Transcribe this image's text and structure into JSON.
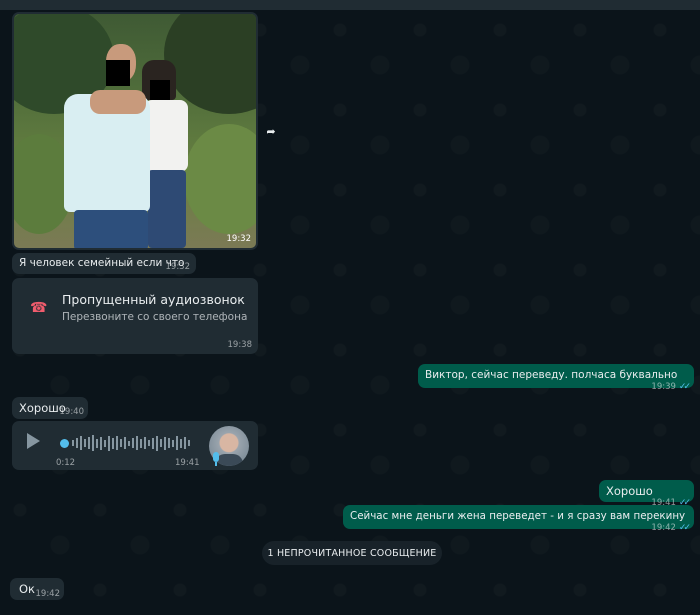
{
  "messages": {
    "photo_time": "19:32",
    "caption": {
      "text": "Я человек семейный если что",
      "time": "19:32"
    },
    "missed_call": {
      "title": "Пропущенный аудиозвонок",
      "subtitle": "Перезвоните со своего телефона",
      "time": "19:38"
    },
    "out1": {
      "text": "Виктор, сейчас переведу. полчаса буквально",
      "time": "19:39"
    },
    "in_ok": {
      "text": "Хорошо",
      "time": "19:40"
    },
    "voice": {
      "duration": "0:12",
      "time": "19:41"
    },
    "out2": {
      "text": "Хорошо",
      "time": "19:41"
    },
    "out3": {
      "text": "Сейчас мне деньги жена переведет - и я сразу вам перекину",
      "time": "19:42"
    },
    "unread_divider": "1 НЕПРОЧИТАННОЕ СООБЩЕНИЕ",
    "last": {
      "text": "Ок",
      "time": "19:42"
    }
  },
  "colors": {
    "background": "#0b141a",
    "incoming_bubble": "#202c33",
    "outgoing_bubble": "#005c4b",
    "read_ticks": "#53bdeb",
    "missed_call_icon": "#f15c6d",
    "voice_accent": "#53bdeb"
  },
  "icons": [
    "share-icon",
    "missed-call-icon",
    "play-icon",
    "microphone-icon",
    "double-check-icon"
  ]
}
